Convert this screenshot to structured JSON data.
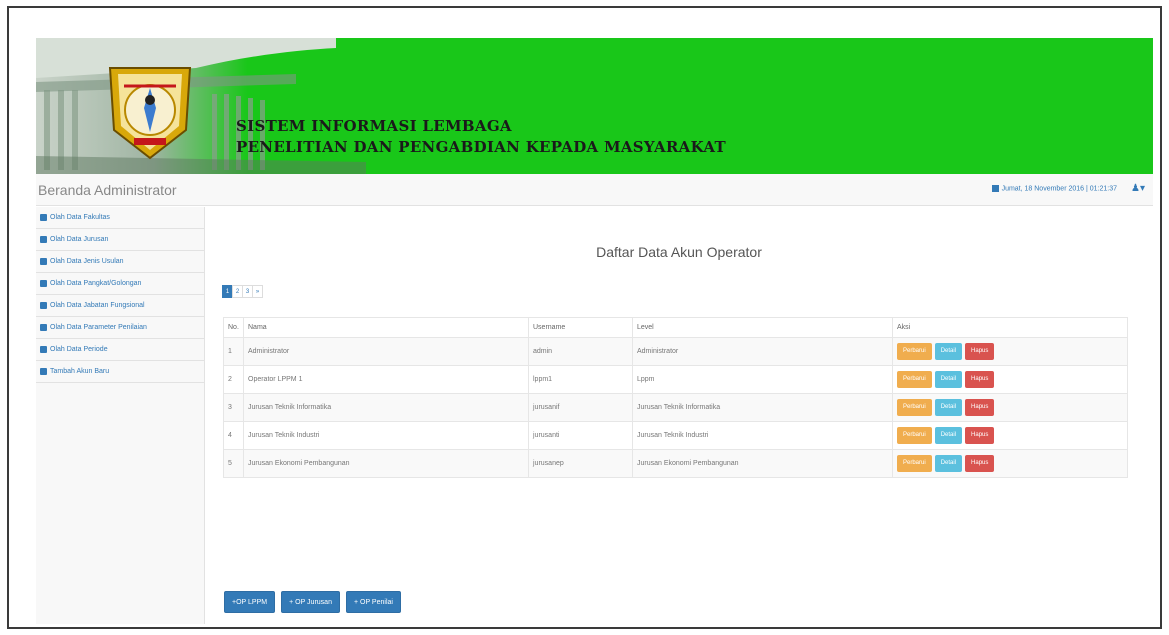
{
  "banner": {
    "title_line1": "SISTEM INFORMASI LEMBAGA",
    "title_line2": "PENELITIAN DAN PENGABDIAN KEPADA MASYARAKAT"
  },
  "navbar": {
    "brand": "Beranda Administrator",
    "datetime": "Jumat, 18 November 2016 | 01:21:37"
  },
  "sidebar": {
    "items": [
      {
        "label": "Olah Data Fakultas",
        "icon": "bank-icon"
      },
      {
        "label": "Olah Data Jurusan",
        "icon": "book-icon"
      },
      {
        "label": "Olah Data Jenis Usulan",
        "icon": "tag-icon"
      },
      {
        "label": "Olah Data Pangkat/Golongan",
        "icon": "users-icon"
      },
      {
        "label": "Olah Data Jabatan Fungsional",
        "icon": "list-icon"
      },
      {
        "label": "Olah Data Parameter Penilaian",
        "icon": "pencil-icon"
      },
      {
        "label": "Olah Data Periode",
        "icon": "calendar-icon"
      },
      {
        "label": "Tambah Akun Baru",
        "icon": "user-icon"
      }
    ]
  },
  "main": {
    "heading": "Daftar Data Akun Operator",
    "pagination": [
      "1",
      "2",
      "3",
      "»"
    ],
    "table": {
      "headers": [
        "No.",
        "Nama",
        "Username",
        "Level",
        "Aksi"
      ],
      "rows": [
        {
          "no": "1",
          "nama": "Administrator",
          "username": "admin",
          "level": "Administrator"
        },
        {
          "no": "2",
          "nama": "Operator LPPM 1",
          "username": "lppm1",
          "level": "Lppm"
        },
        {
          "no": "3",
          "nama": "Jurusan Teknik Informatika",
          "username": "jurusanif",
          "level": "Jurusan Teknik Informatika"
        },
        {
          "no": "4",
          "nama": "Jurusan Teknik Industri",
          "username": "jurusanti",
          "level": "Jurusan Teknik Industri"
        },
        {
          "no": "5",
          "nama": "Jurusan Ekonomi Pembangunan",
          "username": "jurusanep",
          "level": "Jurusan Ekonomi Pembangunan"
        }
      ],
      "actions": {
        "edit": "Perbarui",
        "detail": "Detail",
        "delete": "Hapus"
      }
    },
    "buttons": {
      "op_lppm": "+OP LPPM",
      "op_jurusan": "+ OP Jurusan",
      "op_penilai": "+ OP Penilai"
    }
  },
  "colors": {
    "banner_green": "#19c719",
    "primary": "#337ab7",
    "warning": "#f0ad4e",
    "info": "#5bc0de",
    "danger": "#d9534f"
  }
}
